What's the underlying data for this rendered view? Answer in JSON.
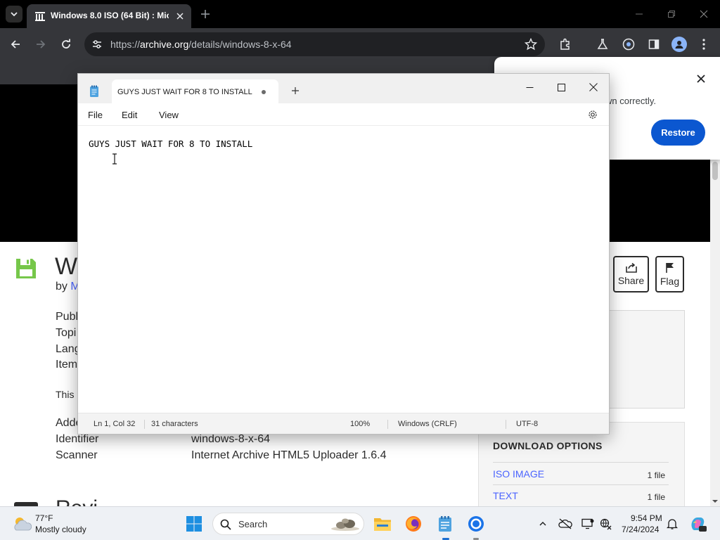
{
  "browser": {
    "tab_title": "Windows 8.0 ISO (64 Bit) : Mic",
    "url_scheme": "https://",
    "url_host": "archive.org",
    "url_path": "/details/windows-8-x-64"
  },
  "restore_popup": {
    "message": "wn correctly.",
    "restore_label": "Restore"
  },
  "notepad": {
    "tab_title": "GUYS JUST WAIT FOR 8 TO INSTALL",
    "menu": [
      "File",
      "Edit",
      "View"
    ],
    "content": "GUYS JUST WAIT FOR 8 TO INSTALL",
    "status": {
      "position": "Ln 1, Col 32",
      "characters": "31 characters",
      "zoom": "100%",
      "line_endings": "Windows (CRLF)",
      "encoding": "UTF-8"
    }
  },
  "page": {
    "title_fragment": "Wi",
    "by_label": "by",
    "by_link_fragment": "M",
    "meta_labels": [
      "Publ",
      "Topi",
      "Lang",
      "Item"
    ],
    "description_fragment": "This",
    "added_fragment": "Adde",
    "identifier_label": "Identifier",
    "identifier_value": "windows-8-x-64",
    "scanner_label": "Scanner",
    "scanner_value": "Internet Archive HTML5 Uploader 1.6.4",
    "reviews_fragment": "Revi",
    "share_label": "Share",
    "flag_label": "Flag",
    "download_title": "DOWNLOAD OPTIONS",
    "downloads": [
      {
        "label": "ISO IMAGE",
        "count": "1 file"
      },
      {
        "label": "TEXT",
        "count": "1 file"
      }
    ],
    "link_color": "#4b64ff"
  },
  "taskbar": {
    "temperature": "77°F",
    "condition": "Mostly cloudy",
    "search_label": "Search",
    "time": "9:54 PM",
    "date": "7/24/2024"
  },
  "colors": {
    "accent_blue": "#0b57d0",
    "chrome_dark": "#35363a",
    "notepad_icon": "#4fa3e0"
  }
}
